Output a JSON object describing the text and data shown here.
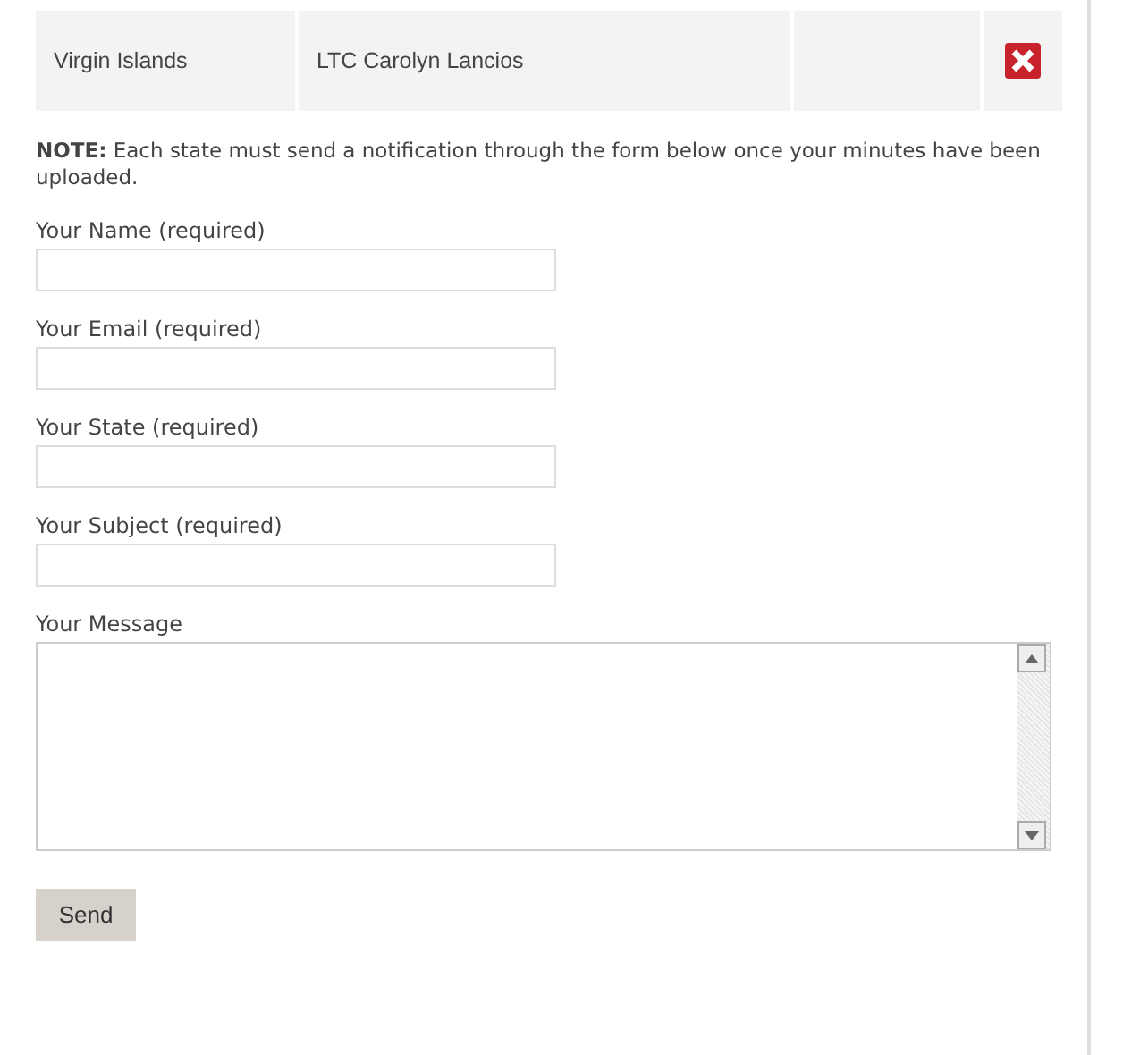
{
  "table": {
    "rows": [
      {
        "cells": [
          "Virgin Islands",
          "LTC Carolyn Lancios",
          ""
        ]
      }
    ]
  },
  "note": "**NOTE:** Each state must send a notification through the form below once your minutes have been uploaded.",
  "form": {
    "fields": [
      {
        "kind": "input",
        "label": "Your Name (required)"
      },
      {
        "kind": "input",
        "label": "Your Email (required)"
      },
      {
        "kind": "input",
        "label": "Your State (required)"
      },
      {
        "kind": "input",
        "label": "Your Subject (required)"
      },
      {
        "kind": "textarea",
        "label": "Your Message"
      }
    ],
    "submit": "Send"
  }
}
